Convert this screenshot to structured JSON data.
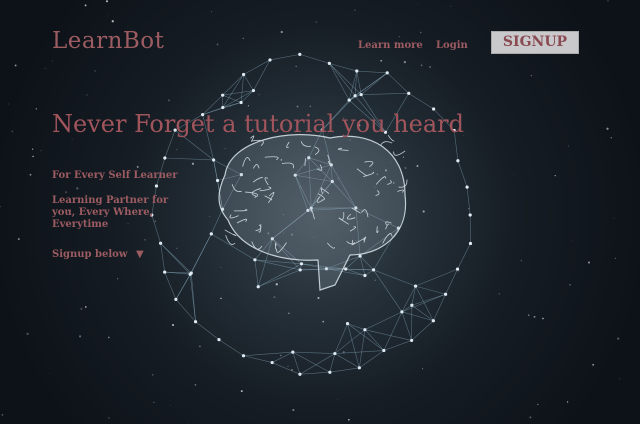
{
  "header": {
    "logo": "LearnBot",
    "nav": [
      {
        "label": "Learn more"
      },
      {
        "label": "Login"
      }
    ],
    "signup_label": "SIGNUP"
  },
  "hero": {
    "title": "Never Forget a tutorial you heard",
    "tagline": "For Every Self Learner",
    "description": "Learning Partner for you, Every Where, Everytime",
    "cta": "Signup below",
    "cta_icon": "▼"
  }
}
